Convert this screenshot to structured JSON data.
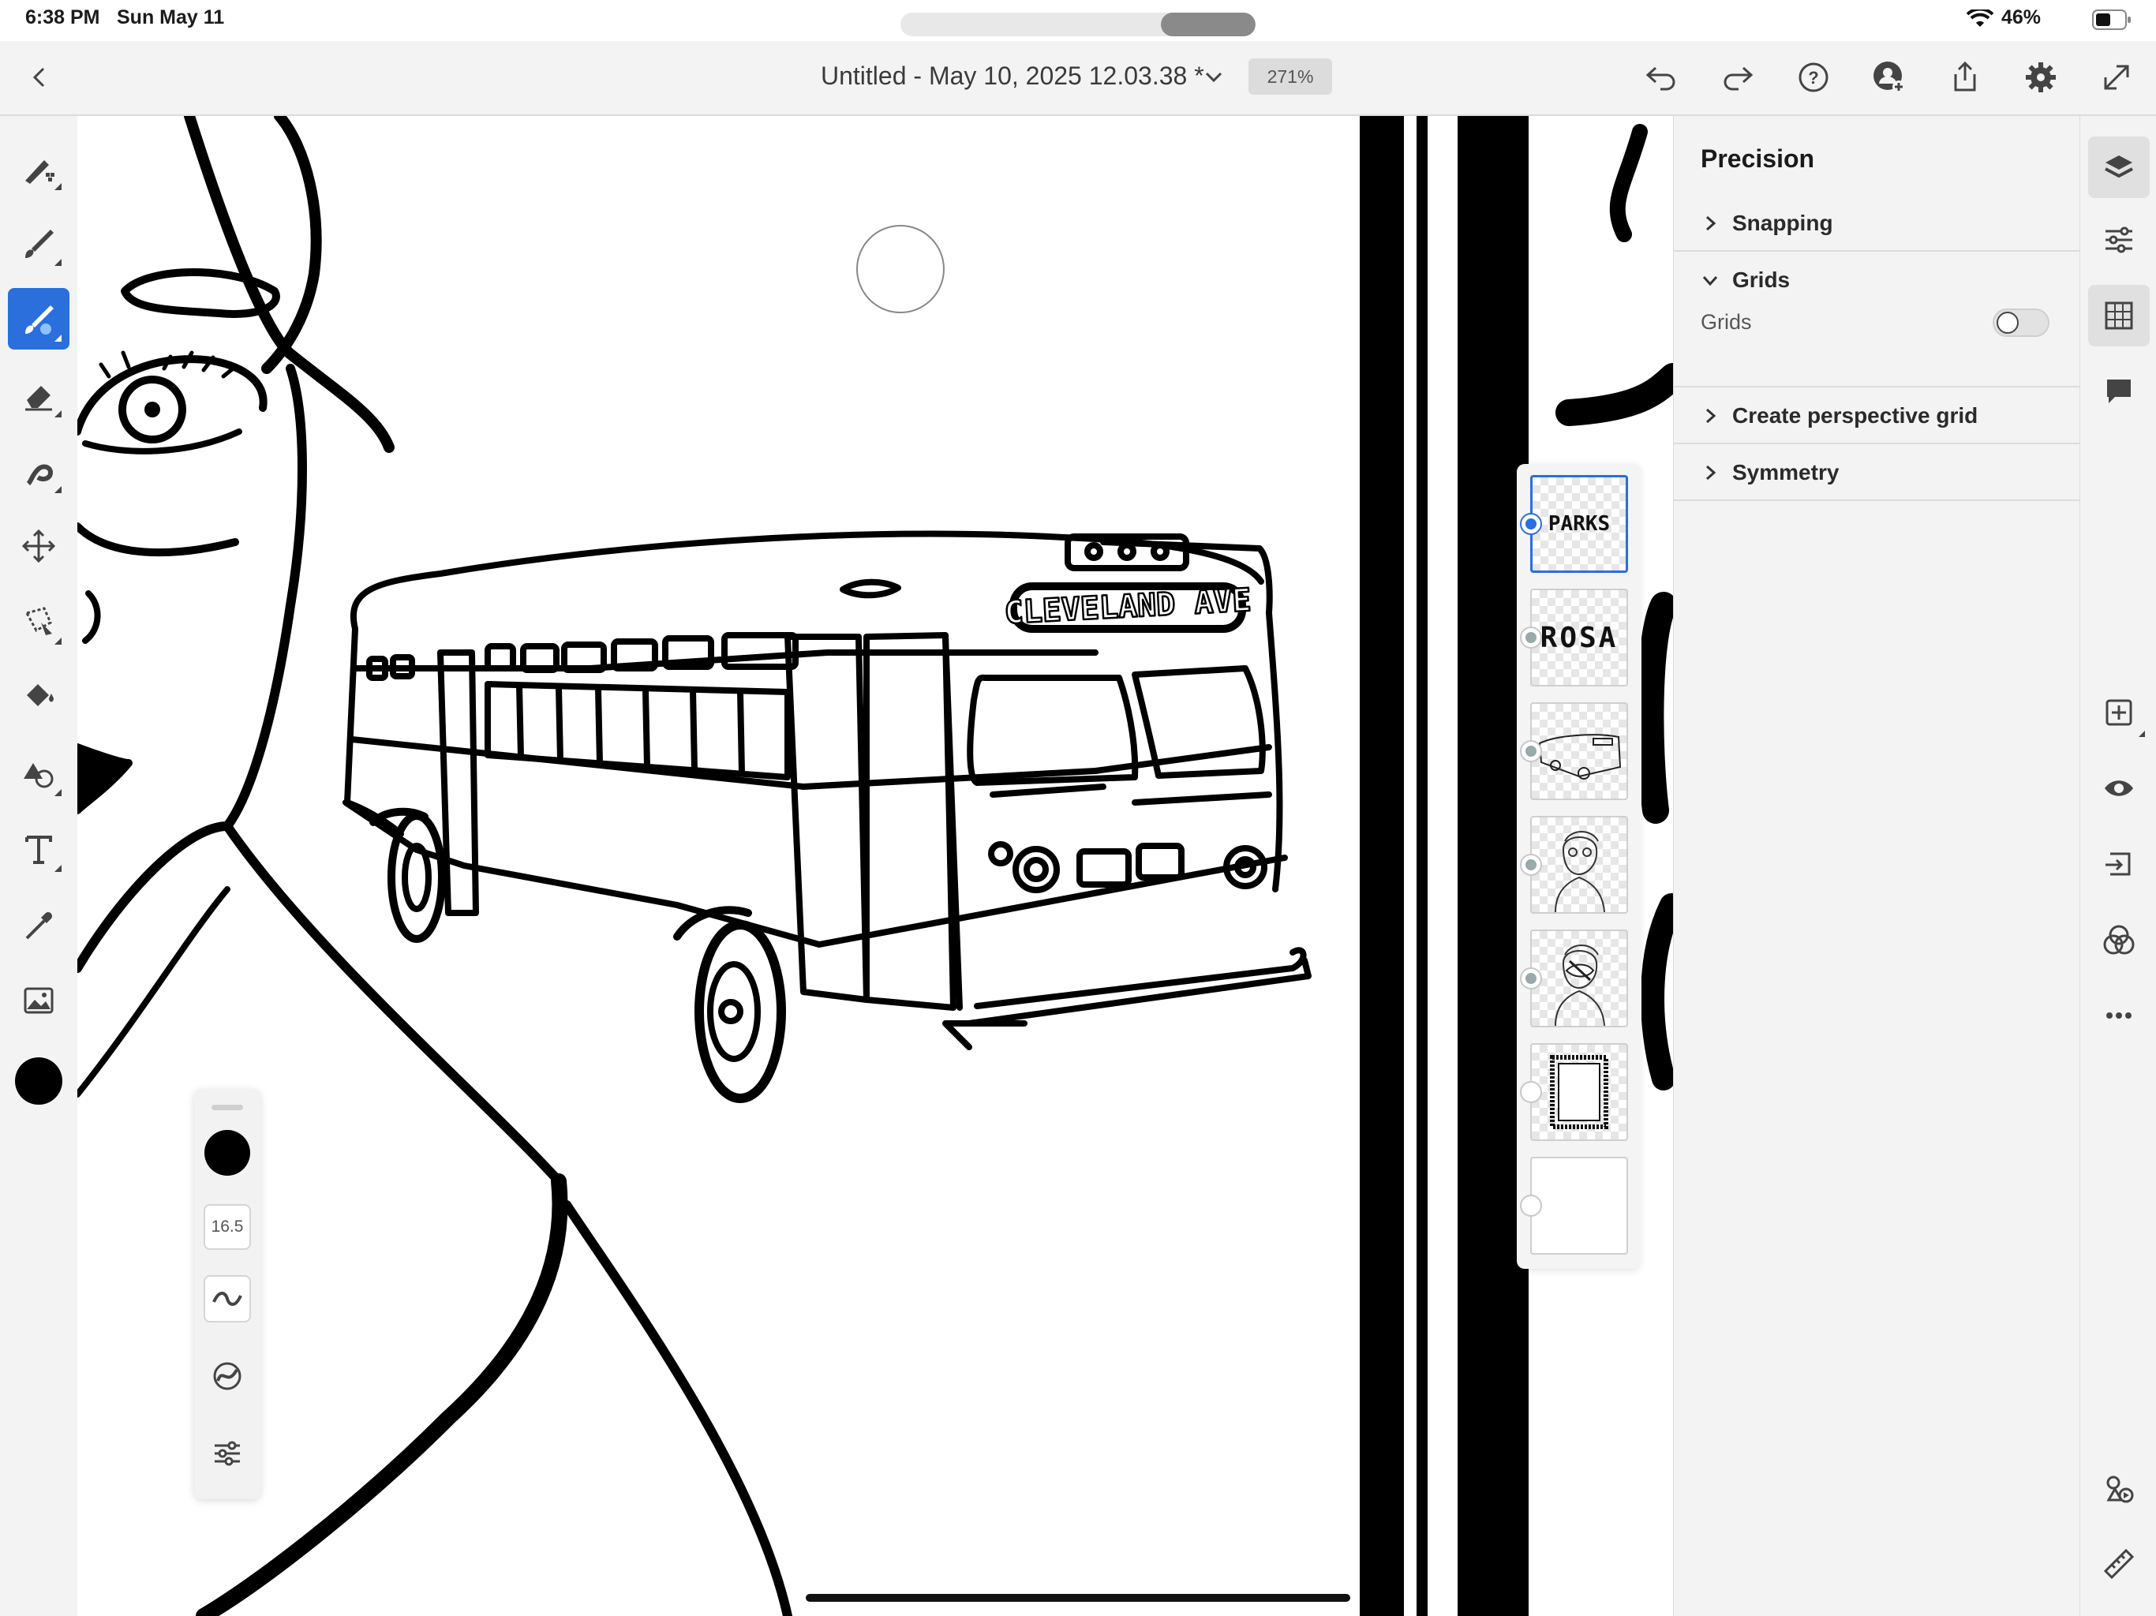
{
  "status_bar": {
    "time": "6:38 PM",
    "date": "Sun May 11",
    "battery_percent": "46%"
  },
  "top_bar": {
    "document_title": "Untitled - May 10, 2025 12.03.38 *",
    "zoom": "271%",
    "icons": [
      "back-icon",
      "chevron-down-icon",
      "undo-icon",
      "redo-icon",
      "help-icon",
      "invite-user-icon",
      "share-icon",
      "settings-icon",
      "fullscreen-icon"
    ]
  },
  "left_tools": [
    "pixel-brush-icon",
    "live-brush-icon",
    "vector-brush-icon",
    "eraser-icon",
    "smudge-icon",
    "transform-icon",
    "selection-icon",
    "fill-icon",
    "shapes-icon",
    "text-icon",
    "eyedropper-icon",
    "place-image-icon"
  ],
  "active_tool": "vector-brush",
  "current_color": "#000000",
  "brush_panel": {
    "size_value": "16.5",
    "color": "#000000"
  },
  "canvas": {
    "bus_destination_sign": "CLEVELAND AVE"
  },
  "layers": [
    {
      "label": "PARKS",
      "selected": true
    },
    {
      "label": "ROSA",
      "selected": false
    },
    {
      "label": "",
      "selected": false
    },
    {
      "label": "",
      "selected": false
    },
    {
      "label": "",
      "selected": false
    },
    {
      "label": "",
      "selected": false
    },
    {
      "label": "",
      "selected": false
    }
  ],
  "precision_panel": {
    "title": "Precision",
    "sections": {
      "snapping": "Snapping",
      "grids": "Grids",
      "grids_toggle_label": "Grids",
      "perspective": "Create perspective grid",
      "symmetry": "Symmetry"
    },
    "grids_enabled": false
  },
  "right_rail": [
    "layers-icon",
    "adjustments-icon",
    "precision-grid-icon",
    "comments-icon",
    "add-layer-icon",
    "visibility-icon",
    "import-icon",
    "blend-icon",
    "more-icon",
    "libraries-icon",
    "ruler-icon"
  ],
  "accent_color": "#2a6fdb"
}
